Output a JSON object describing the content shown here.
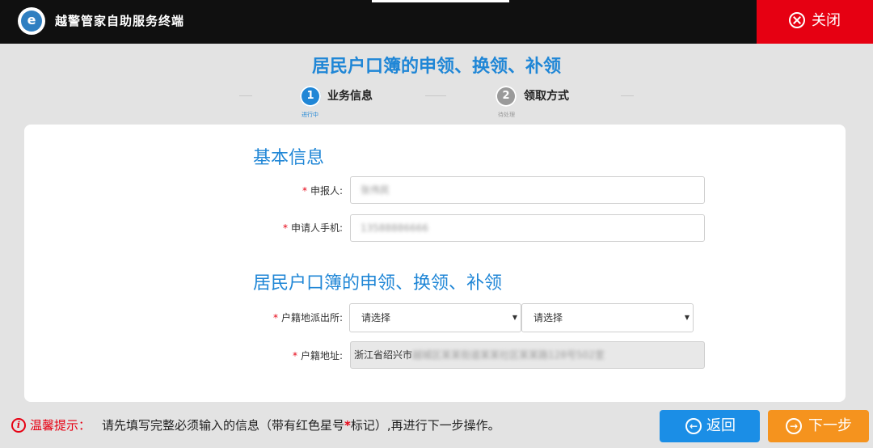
{
  "app": {
    "title": "越警管家自助服务终端",
    "logo_text": "e"
  },
  "header": {
    "close_label": "关闭"
  },
  "page": {
    "title": "居民户口簿的申领、换领、补领"
  },
  "steps": [
    {
      "number": "1",
      "label": "业务信息",
      "sub": "进行中",
      "color": "#1f86d6"
    },
    {
      "number": "2",
      "label": "领取方式",
      "sub": "待处理",
      "color": "#9a9a9a"
    }
  ],
  "sections": {
    "basic": {
      "title": "基本信息"
    },
    "household": {
      "title": "居民户口簿的申领、换领、补领"
    }
  },
  "form": {
    "required_mark": "*",
    "applicant": {
      "label": "申报人:",
      "value": "张伟民"
    },
    "phone": {
      "label": "申请人手机:",
      "value": "13588886666"
    },
    "police_station": {
      "label": "户籍地派出所:",
      "select1": "请选择",
      "select2": "请选择"
    },
    "address": {
      "label": "户籍地址:",
      "prefix": "浙江省绍兴市",
      "rest": "越城区某某街道某某社区某某路128号502室"
    }
  },
  "footer": {
    "tip_icon": "i",
    "tip_label": "温馨提示：",
    "tip_before": "请先填写完整必须输入的信息（带有红色星号",
    "tip_star": "*",
    "tip_after": "标记）,再进行下一步操作。",
    "back_label": "返回",
    "next_label": "下一步"
  },
  "colors": {
    "accent_blue": "#1f86d6",
    "danger_red": "#e60012",
    "back_button": "#1b8ee6",
    "next_button": "#f5931e"
  }
}
